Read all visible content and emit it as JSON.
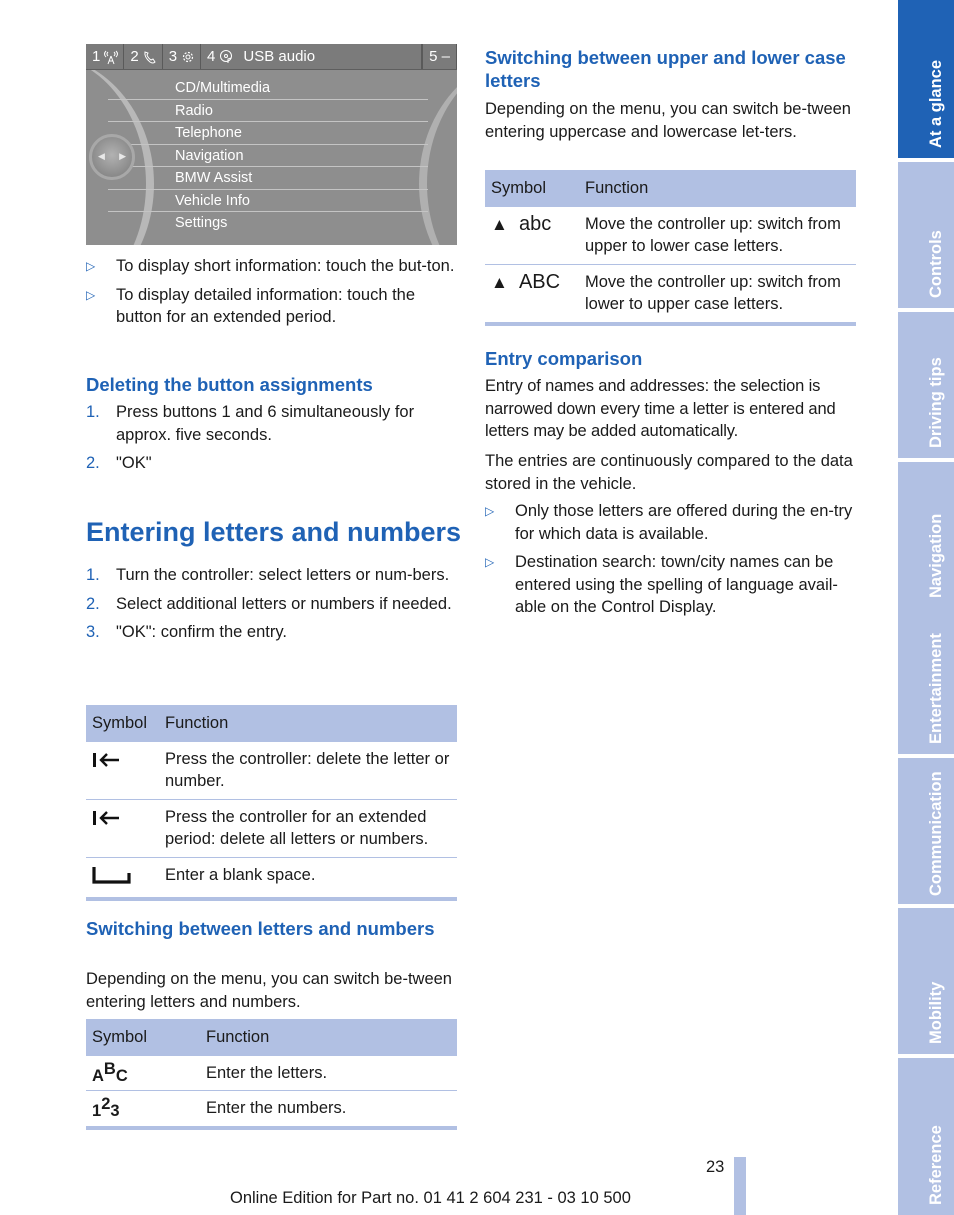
{
  "screen": {
    "topbar": [
      {
        "number": "1",
        "icon": "radio-waves-icon"
      },
      {
        "number": "2",
        "icon": "phone-icon"
      },
      {
        "number": "3",
        "icon": "settings-gear-icon"
      },
      {
        "number": "4",
        "icon": "music-disc-icon",
        "label": "USB audio"
      }
    ],
    "topbar_last": "5 –",
    "menu": [
      "CD/Multimedia",
      "Radio",
      "Telephone",
      "Navigation",
      "BMW Assist",
      "Vehicle Info",
      "Settings"
    ],
    "knob_left": "◀",
    "knob_right": "▶"
  },
  "left": {
    "intro_bullets": [
      "To display short information: touch the but-ton.",
      "To display detailed information: touch the button for an extended period."
    ],
    "deleting": {
      "heading": "Deleting the button assignments",
      "steps": [
        {
          "n": "1.",
          "text": "Press buttons 1 and 6 simultaneously for approx. five seconds."
        },
        {
          "n": "2.",
          "text": "\"OK\""
        }
      ]
    },
    "entering": {
      "heading": "Entering letters and numbers",
      "steps": [
        {
          "n": "1.",
          "text": "Turn the controller: select letters or num-bers."
        },
        {
          "n": "2.",
          "text": "Select additional letters or numbers if needed."
        },
        {
          "n": "3.",
          "text": "\"OK\": confirm the entry."
        }
      ],
      "table": {
        "headers": [
          "Symbol",
          "Function"
        ],
        "rows": [
          {
            "symbol": "delete-letter-icon",
            "function": "Press the controller: delete the letter or number."
          },
          {
            "symbol": "delete-all-icon",
            "function": "Press the controller for an extended period: delete all letters or numbers."
          },
          {
            "symbol": "blank-space-icon",
            "function": "Enter a blank space."
          }
        ]
      }
    },
    "switching_letters_numbers": {
      "heading": "Switching between letters and numbers",
      "body": "Depending on the menu, you can switch be-tween entering letters and numbers.",
      "table": {
        "headers": [
          "Symbol",
          "Function"
        ],
        "rows": [
          {
            "symbol_parts": [
              "A",
              "B",
              "C"
            ],
            "function": "Enter the letters."
          },
          {
            "symbol_parts": [
              "1",
              "2",
              "3"
            ],
            "function": "Enter the numbers."
          }
        ]
      }
    }
  },
  "right": {
    "switching_case": {
      "heading": "Switching between upper and lower case letters",
      "body": "Depending on the menu, you can switch be-tween entering uppercase and lowercase let-ters.",
      "table": {
        "headers": [
          "Symbol",
          "Function"
        ],
        "rows": [
          {
            "arrow": "▲",
            "label": "abc",
            "function": "Move the controller up: switch from upper to lower case letters."
          },
          {
            "arrow": "▲",
            "label": "ABC",
            "function": "Move the controller up: switch from lower to upper case letters."
          }
        ]
      }
    },
    "entry_comparison": {
      "heading": "Entry comparison",
      "para1": "Entry of names and addresses: the selection is narrowed down every time a letter is entered and letters may be added automatically.",
      "para2": "The entries are continuously compared to the data stored in the vehicle.",
      "bullets": [
        "Only those letters are offered during the en-try for which data is available.",
        "Destination search: town/city names can be entered using the spelling of language avail-able on the Control Display."
      ]
    }
  },
  "sidebar": {
    "tabs": [
      {
        "label": "At a glance",
        "active": true
      },
      {
        "label": "Controls",
        "active": false
      },
      {
        "label": "Driving tips",
        "active": false
      },
      {
        "label": "Navigation",
        "active": false
      },
      {
        "label": "Entertainment",
        "active": false
      },
      {
        "label": "Communication",
        "active": false
      },
      {
        "label": "Mobility",
        "active": false
      },
      {
        "label": "Reference",
        "active": false
      }
    ]
  },
  "footer": {
    "page_number": "23",
    "edition": "Online Edition for Part no. 01 41 2 604 231 - 03 10 500"
  },
  "colors": {
    "accent": "#1f62b5",
    "table_tint": "#b1c0e3"
  }
}
